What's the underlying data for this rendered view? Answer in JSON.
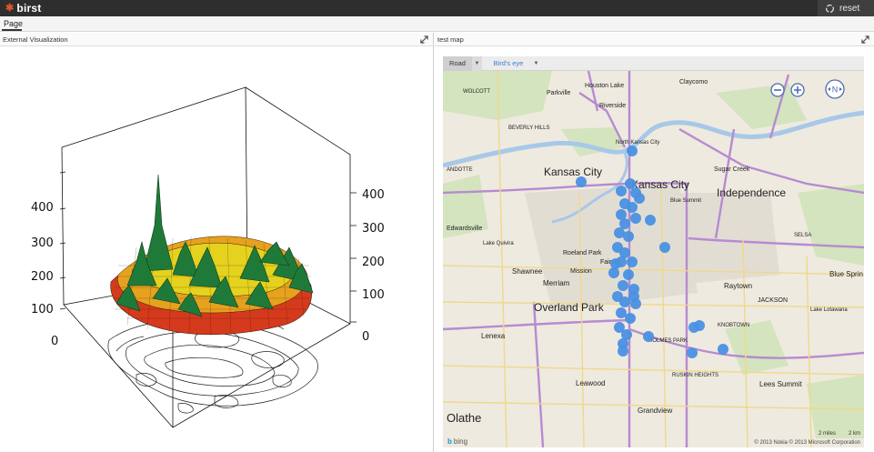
{
  "app": {
    "logo_text": "birst",
    "reset_label": "reset"
  },
  "tabs": [
    {
      "label": "Page",
      "active": true
    }
  ],
  "panels": {
    "left": {
      "title": "External Visualization"
    },
    "right": {
      "title": "test map"
    }
  },
  "surface_plot": {
    "left_axis_ticks": [
      "400",
      "300",
      "200",
      "100",
      "0"
    ],
    "right_axis_ticks": [
      "400",
      "300",
      "200",
      "100",
      "0"
    ],
    "colors": {
      "peak": "#1f7a3a",
      "mid": "#d3c31e",
      "low": "#c9321e",
      "contour": "#222222"
    }
  },
  "map": {
    "toolbar": {
      "road_label": "Road",
      "birds_eye_label": "Bird's eye"
    },
    "marker_color": "#4a90e2",
    "places": {
      "kansas_city_ks": "Kansas City",
      "kansas_city_mo": "Kansas City",
      "independence": "Independence",
      "overland_park": "Overland Park",
      "olathe": "Olathe",
      "raytown": "Raytown",
      "lenexa": "Lenexa",
      "leawood": "Leawood",
      "shawnee": "Shawnee",
      "merriam": "Merriam",
      "grandview": "Grandview",
      "lees_summit": "Lees Summit",
      "blue_springs": "Blue Sprin",
      "sugar_creek": "Sugar Creek",
      "edwardsville": "Edwardsville",
      "lake_quivira": "Lake Quivira",
      "roeland_park": "Roeland Park",
      "mission": "Mission",
      "fairway": "Fairwa",
      "riverside": "Riverside",
      "parkville": "Parkville",
      "houston_lake": "Houston Lake",
      "claycomo": "Claycomo",
      "north_kansas_city": "North Kansas City",
      "beverly_hills": "BEVERLY HILLS",
      "wolcott": "WOLCOTT",
      "andotte": "ANDOTTE",
      "blue_summit": "Blue Summit",
      "knobtown": "KNOBTOWN",
      "jackson": "JACKSON",
      "lake_lotawana": "Lake Lotawana",
      "selsa": "SELSA",
      "ruskin_heights": "RUSKIN HEIGHTS",
      "holmes_park": "HOLMES PARK"
    },
    "attribution": "© 2013 Nokia  © 2013 Microsoft Corporation",
    "bing_label": "bing",
    "scale": {
      "miles": "2 miles",
      "km": "2 km"
    }
  }
}
